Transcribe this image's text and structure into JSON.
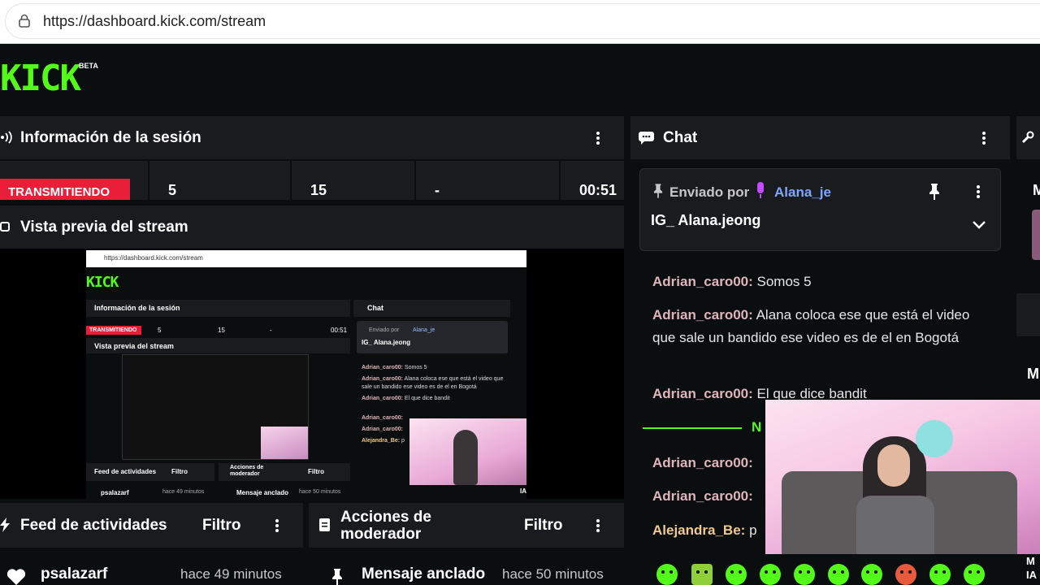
{
  "browser": {
    "url": "https://dashboard.kick.com/stream"
  },
  "brand": {
    "logo": "KICK",
    "badge": "BETA",
    "color": "#53fc18"
  },
  "session": {
    "title": "Información de la sesión",
    "status": "TRANSMITIENDO",
    "stats": [
      "5",
      "15",
      "-",
      "00:51"
    ]
  },
  "preview": {
    "title": "Vista previa del stream",
    "url": "https://dashboard.kick.com/stream",
    "logo": "KICK",
    "session_title": "Información de la sesión",
    "status": "TRANSMITIENDO",
    "stats": [
      "5",
      "15",
      "-",
      "00:51"
    ],
    "preview_title": "Vista previa del stream",
    "chat_title": "Chat",
    "pinned_label": "Enviado por",
    "pinned_user": "Alana_je",
    "pinned_text": "IG_ Alana.jeong",
    "messages": [
      {
        "user": "Adrian_caro00:",
        "text": "Somos 5"
      },
      {
        "user": "Adrian_caro00:",
        "text": "Alana coloca ese que está el video que sale un bandido ese video es de el en Bogotá"
      },
      {
        "user": "Adrian_caro00:",
        "text": "El que dice bandit"
      },
      {
        "user": "Adrian_caro00:",
        "text": ""
      },
      {
        "user": "Adrian_caro00:",
        "text": ""
      },
      {
        "user": "Alejandra_Be:",
        "text": "p"
      }
    ],
    "feed_title": "Feed de actividades",
    "filter": "Filtro",
    "mod_title": "Acciones de moderador",
    "feed_user": "psalazarf",
    "feed_time": "hace 49 minutos",
    "mod_item": "Mensaje anclado",
    "mod_time": "hace 50 minutos",
    "side_label": "IA"
  },
  "chat": {
    "title": "Chat",
    "pinned_label": "Enviado por",
    "pinned_user": "Alana_je",
    "pinned_text": "IG_ Alana.jeong",
    "messages": [
      {
        "user": "Adrian_caro00:",
        "text": "Somos 5"
      },
      {
        "user": "Adrian_caro00:",
        "text": "Alana coloca ese que está el video que sale un bandido ese video es de el en Bogotá"
      },
      {
        "user": "Adrian_caro00:",
        "text": "El que dice bandit"
      },
      {
        "user": "Adrian_caro00:",
        "text": ""
      },
      {
        "user": "Adrian_caro00:",
        "text": ""
      },
      {
        "user": "Alejandra_Be:",
        "text": "p"
      }
    ],
    "divider_text": "N"
  },
  "feed": {
    "title": "Feed de actividades",
    "filter": "Filtro",
    "item_user": "psalazarf",
    "item_time": "hace 49 minutos"
  },
  "moderator": {
    "title_line1": "Acciones de",
    "title_line2": "moderador",
    "filter": "Filtro",
    "item_label": "Mensaje anclado",
    "item_time": "hace 50 minutos"
  },
  "right_edge": {
    "labels": [
      "M",
      "M",
      "M",
      "IA"
    ]
  }
}
